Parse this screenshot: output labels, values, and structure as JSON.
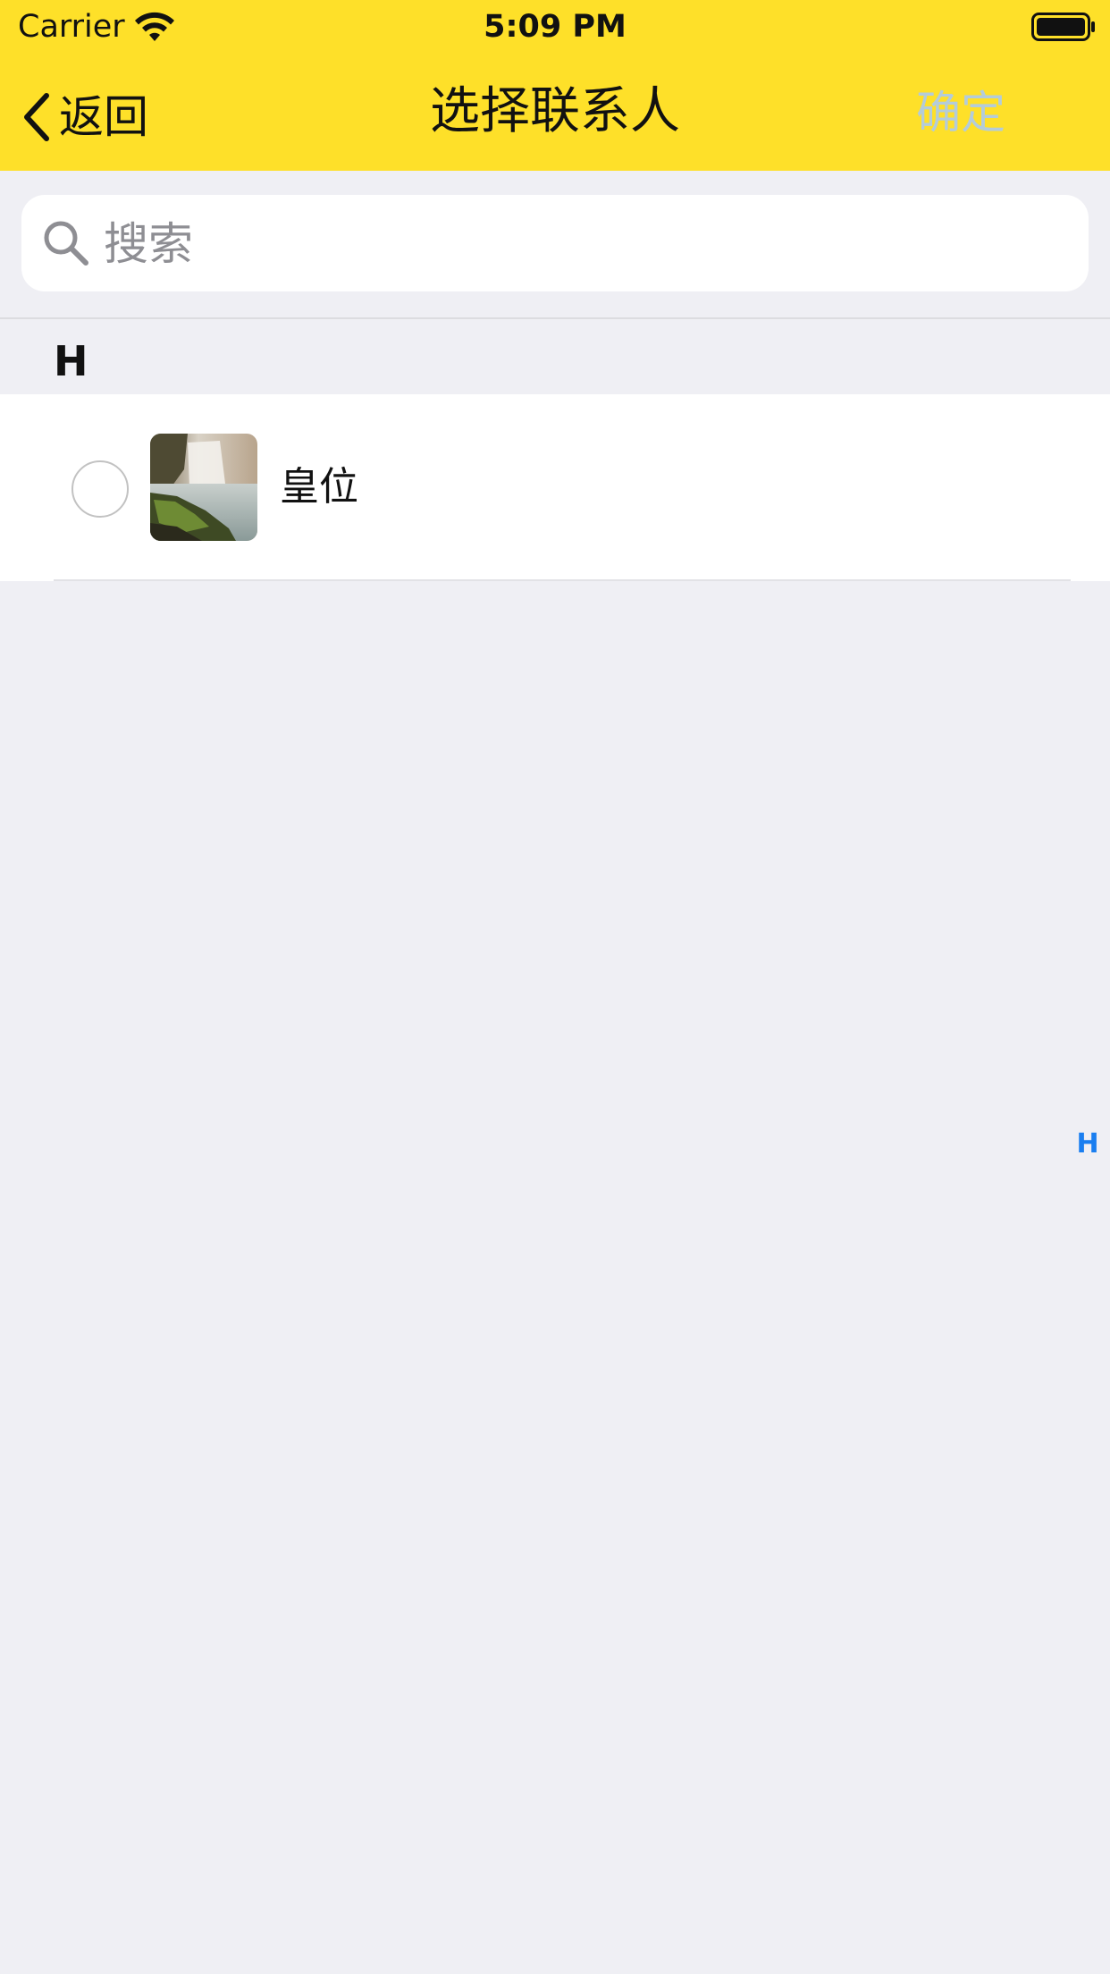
{
  "status_bar": {
    "carrier": "Carrier",
    "time": "5:09 PM",
    "wifi_icon": "wifi-icon",
    "battery_icon": "battery-icon"
  },
  "nav": {
    "back_label": "返回",
    "back_icon": "chevron-left-icon",
    "title": "选择联系人",
    "confirm_label": "确定"
  },
  "search": {
    "placeholder": "搜索",
    "value": "",
    "icon": "search-icon"
  },
  "sections": [
    {
      "letter": "H",
      "contacts": [
        {
          "name": "皇位",
          "selected": false,
          "avatar": "waterfall-photo"
        }
      ]
    }
  ],
  "index": [
    "H"
  ],
  "colors": {
    "nav_background": "#fee029",
    "confirm_disabled": "#b4ccd9",
    "index_accent": "#1a7ef0",
    "page_background": "#efeff4"
  }
}
